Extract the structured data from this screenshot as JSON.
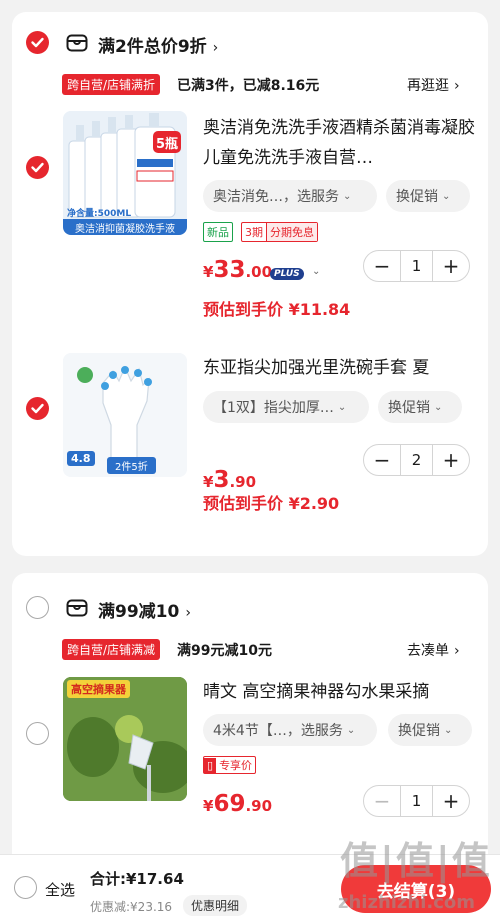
{
  "colors": {
    "accent": "#e6262e",
    "background": "#f2f2f2"
  },
  "groups": [
    {
      "title": "满2件总价9折",
      "tag": "跨自营/店铺满折",
      "status": "已满3件，已减8.16元",
      "link": "再逛逛",
      "items": [
        {
          "title": "奥洁消免洗洗手液酒精杀菌消毒凝胶儿童免洗洗手液自营…",
          "image_badge": "5瓶",
          "image_caption": "奥洁消抑菌凝胶洗手液",
          "image_volume": "净含量:500ML",
          "spec": "奥洁消免…，选服务",
          "promo": "换促销",
          "badges": [
            "新品",
            "3期",
            "分期免息"
          ],
          "price_symbol": "¥",
          "price_int": "33",
          "price_dec": ".00",
          "plus_label": "PLUS",
          "estimate": "预估到手价 ¥11.84",
          "quantity": "1",
          "checked": true
        },
        {
          "title": "东亚指尖加强光里洗碗手套 夏",
          "image_rating": "4.8",
          "image_caption": "2件5折",
          "spec": "【1双】指尖加厚…",
          "promo": "换促销",
          "price_symbol": "¥",
          "price_int": "3",
          "price_dec": ".90",
          "estimate": "预估到手价 ¥2.90",
          "quantity": "2",
          "checked": true
        }
      ],
      "checked": true
    },
    {
      "title": "满99减10",
      "tag": "跨自营/店铺满减",
      "status": "满99元减10元",
      "link": "去凑单",
      "items": [
        {
          "title": "晴文 高空摘果神器勾水果采摘",
          "image_caption": "高空摘果器",
          "spec": "4米4节【…，选服务",
          "promo": "换促销",
          "exclusive": "专享价",
          "price_symbol": "¥",
          "price_int": "69",
          "price_dec": ".90",
          "quantity": "1",
          "checked": false
        }
      ],
      "checked": false
    }
  ],
  "footer": {
    "select_all": "全选",
    "total": "合计:¥17.64",
    "discount": "优惠减:¥23.16",
    "detail": "优惠明细",
    "checkout": "去结算(3)"
  },
  "watermark": {
    "logo": "值|值|值",
    "site": "zhizhizhi.com"
  }
}
